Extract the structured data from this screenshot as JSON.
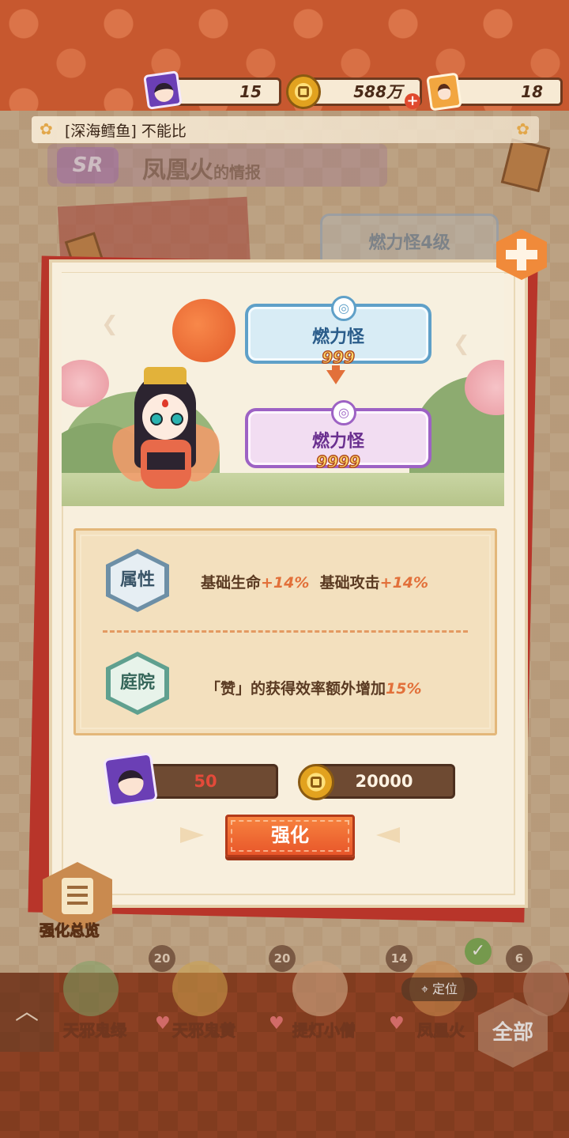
{
  "resources": {
    "avatar_count": "15",
    "coins": "588万",
    "cards": "18"
  },
  "marquee": {
    "text": "[深海鳕鱼] 不能比"
  },
  "background_info": {
    "rarity": "SR",
    "name": "凤凰火",
    "suffix": "的情报",
    "ghost_card": "燃力怪4级"
  },
  "upgrade": {
    "current": {
      "name": "燃力怪",
      "level": "999"
    },
    "next": {
      "name": "燃力怪",
      "level": "9999"
    }
  },
  "attributes": {
    "attr_label": "属性",
    "attr_part1": "基础生命",
    "attr_val1": "+14%",
    "attr_part2": "基础攻击",
    "attr_val2": "+14%",
    "yard_label": "庭院",
    "yard_prefix": "「赞」的获得效率额外增加",
    "yard_val": "15%"
  },
  "cost": {
    "avatar_cost": "50",
    "coin_cost": "20000"
  },
  "buttons": {
    "enhance": "强化",
    "overview": "强化总览",
    "all": "全部",
    "locate": "定位"
  },
  "roster": [
    {
      "level": "",
      "name": "天邪鬼绿"
    },
    {
      "level": "20",
      "name": "天邪鬼黄"
    },
    {
      "level": "20",
      "name": "提灯小僧"
    },
    {
      "level": "14",
      "name": "凤凰火"
    },
    {
      "level": "6",
      "name": ""
    }
  ],
  "colors": {
    "accent_orange": "#e8562a",
    "blue_card": "#5fa0c8",
    "purple_card": "#9d62c4",
    "panel_bg": "#f8efdd"
  }
}
